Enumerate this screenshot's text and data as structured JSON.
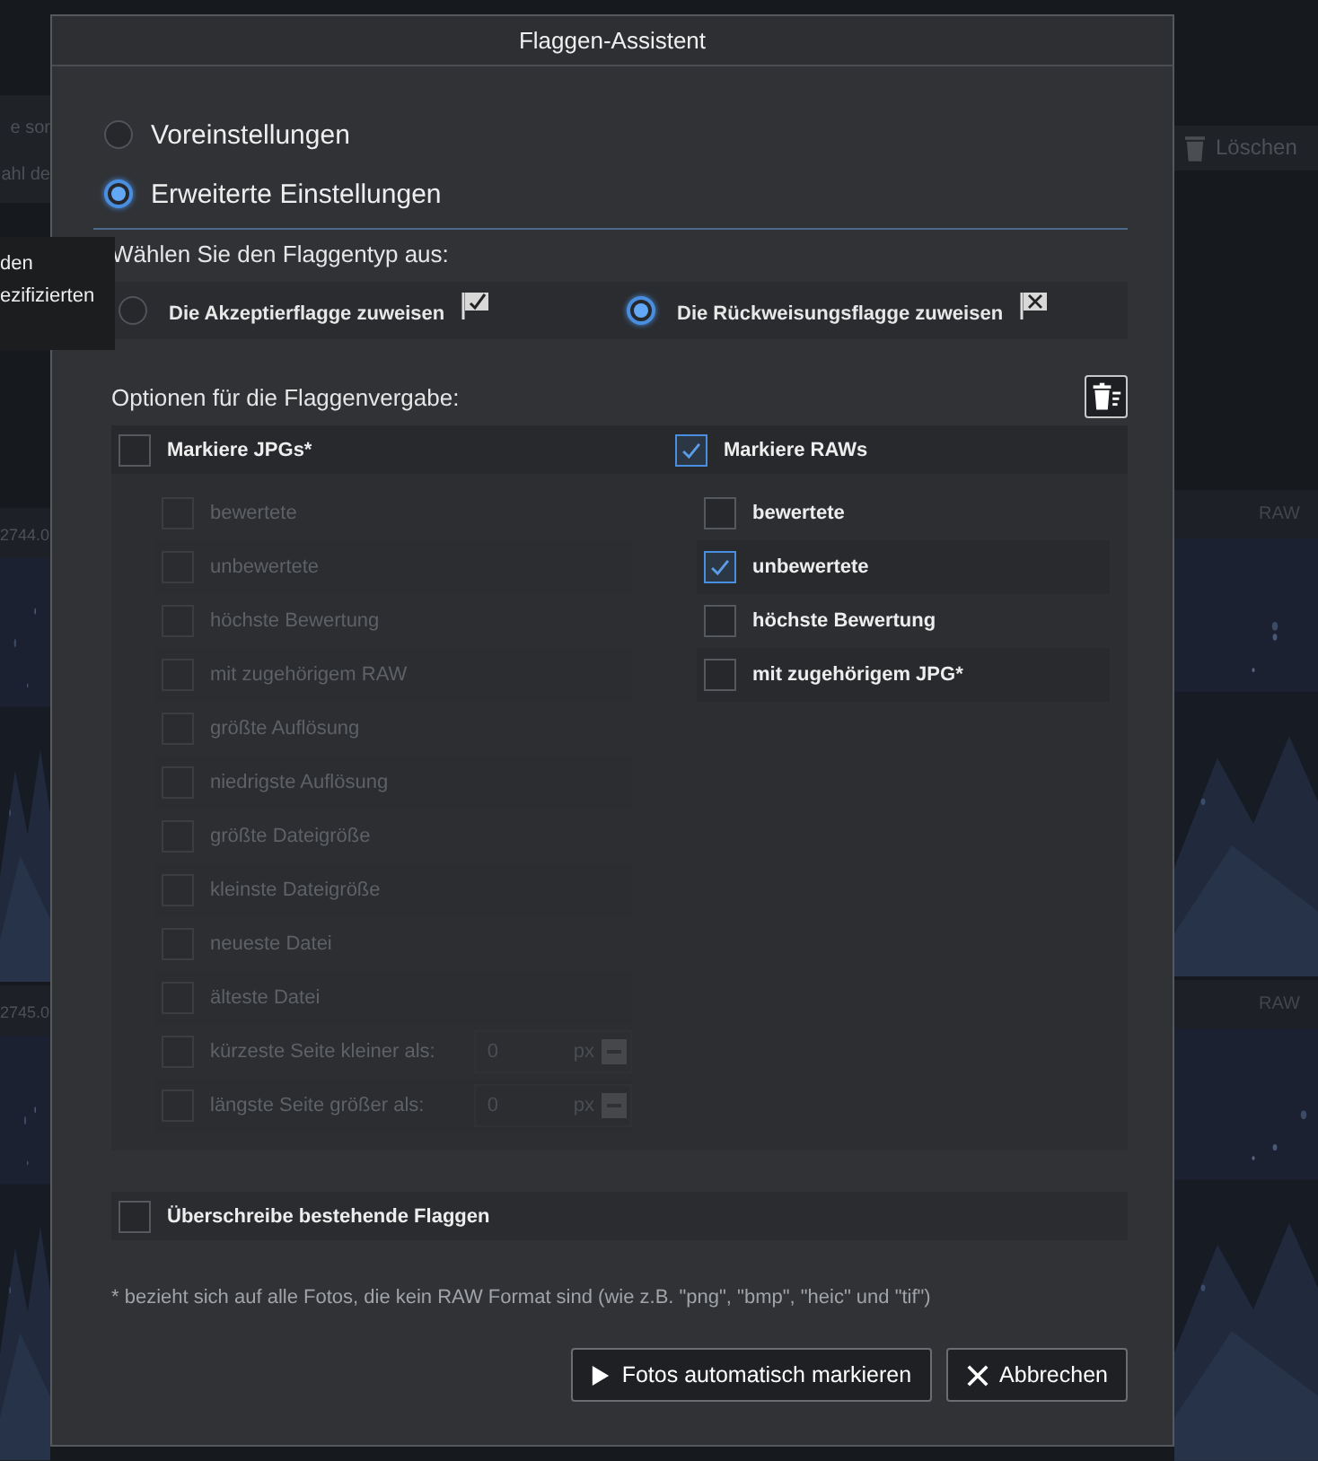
{
  "background": {
    "left_texts": [
      "e sor",
      "ahl de"
    ],
    "left_cards": [
      {
        "caption": "2744.0"
      },
      {
        "caption": "2745.0"
      }
    ],
    "toolbar_button": "Löschen",
    "right_cards": [
      {
        "badge": "RAW"
      },
      {
        "badge": "RAW"
      }
    ],
    "tooltip_lines": [
      "den",
      "ezifizierten"
    ]
  },
  "dialog": {
    "title": "Flaggen-Assistent",
    "modes": [
      {
        "label": "Voreinstellungen",
        "selected": false
      },
      {
        "label": "Erweiterte Einstellungen",
        "selected": true
      }
    ],
    "flag_type": {
      "heading": "Wählen Sie den Flaggentyp aus:",
      "options": [
        {
          "label": "Die Akzeptierflagge zuweisen",
          "kind": "accept",
          "selected": false
        },
        {
          "label": "Die Rückweisungsflagge zuweisen",
          "kind": "reject",
          "selected": true
        }
      ]
    },
    "options": {
      "heading": "Optionen für die Flaggenvergabe:",
      "groups": [
        {
          "label": "Markiere JPGs*",
          "checked": false,
          "items": [
            {
              "kind": "check",
              "label": "bewertete",
              "checked": false,
              "disabled": true
            },
            {
              "kind": "check",
              "label": "unbewertete",
              "checked": false,
              "disabled": true
            },
            {
              "kind": "check",
              "label": "höchste Bewertung",
              "checked": false,
              "disabled": true
            },
            {
              "kind": "check",
              "label": "mit zugehörigem RAW",
              "checked": false,
              "disabled": true
            },
            {
              "kind": "check",
              "label": "größte Auflösung",
              "checked": false,
              "disabled": true
            },
            {
              "kind": "check",
              "label": "niedrigste Auflösung",
              "checked": false,
              "disabled": true
            },
            {
              "kind": "check",
              "label": "größte Dateigröße",
              "checked": false,
              "disabled": true
            },
            {
              "kind": "check",
              "label": "kleinste Dateigröße",
              "checked": false,
              "disabled": true
            },
            {
              "kind": "check",
              "label": "neueste Datei",
              "checked": false,
              "disabled": true
            },
            {
              "kind": "check",
              "label": "älteste Datei",
              "checked": false,
              "disabled": true
            },
            {
              "kind": "size",
              "label": "kürzeste Seite kleiner als:",
              "checked": false,
              "disabled": true,
              "value": "0",
              "unit": "px"
            },
            {
              "kind": "size",
              "label": "längste Seite größer als:",
              "checked": false,
              "disabled": true,
              "value": "0",
              "unit": "px"
            }
          ]
        },
        {
          "label": "Markiere RAWs",
          "checked": true,
          "items": [
            {
              "kind": "check",
              "label": "bewertete",
              "checked": false,
              "disabled": false
            },
            {
              "kind": "check",
              "label": "unbewertete",
              "checked": true,
              "disabled": false
            },
            {
              "kind": "check",
              "label": "höchste Bewertung",
              "checked": false,
              "disabled": false
            },
            {
              "kind": "check",
              "label": "mit zugehörigem JPG*",
              "checked": false,
              "disabled": false
            }
          ]
        }
      ]
    },
    "overwrite": {
      "label": "Überschreibe bestehende Flaggen",
      "checked": false
    },
    "footnote": "* bezieht sich auf alle Fotos, die kein RAW Format sind (wie z.B. \"png\", \"bmp\", \"heic\" und \"tif\")",
    "buttons": [
      {
        "label": "Fotos automatisch markieren",
        "kind": "run"
      },
      {
        "label": "Abbrechen",
        "kind": "cancel"
      }
    ]
  }
}
